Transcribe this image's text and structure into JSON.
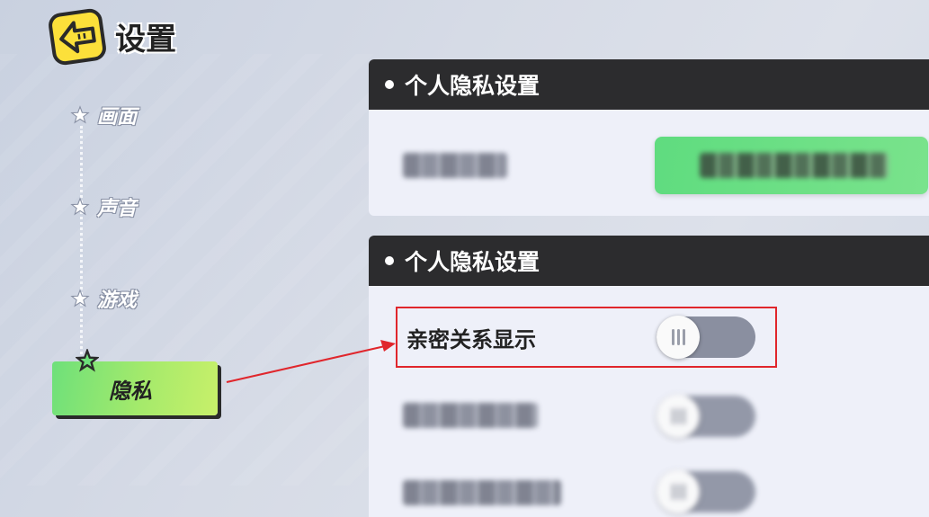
{
  "header": {
    "title": "设置",
    "back_icon": "back-arrow-icon"
  },
  "sidebar": {
    "items": [
      {
        "label": "画面",
        "icon": "star-icon",
        "active": false
      },
      {
        "label": "声音",
        "icon": "star-icon",
        "active": false
      },
      {
        "label": "游戏",
        "icon": "star-icon",
        "active": false
      },
      {
        "label": "隐私",
        "icon": "star-icon",
        "active": true
      }
    ]
  },
  "panels": [
    {
      "title": "个人隐私设置",
      "rows": [
        {
          "label": "",
          "control": "button",
          "button_label": "",
          "blurred": true
        }
      ]
    },
    {
      "title": "个人隐私设置",
      "rows": [
        {
          "label": "亲密关系显示",
          "control": "toggle",
          "on": false,
          "blurred": false
        },
        {
          "label": "",
          "control": "toggle",
          "on": false,
          "blurred": true
        },
        {
          "label": "",
          "control": "toggle",
          "on": false,
          "blurred": true
        }
      ]
    }
  ],
  "colors": {
    "accent_green": "#7ae38c",
    "header_dark": "#2c2c2e",
    "highlight_red": "#e0262c",
    "back_button_yellow": "#fce03a"
  }
}
